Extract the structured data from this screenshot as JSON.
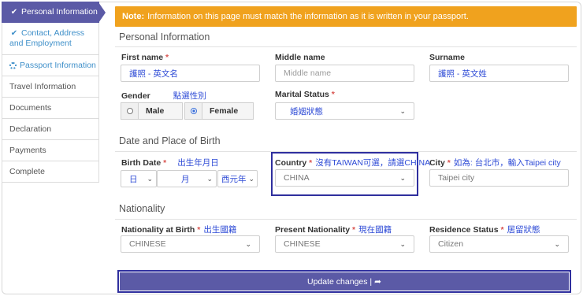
{
  "sidebar": {
    "items": [
      {
        "label": "Personal Information",
        "icon": "check"
      },
      {
        "label": "Contact, Address and Employment",
        "icon": "check"
      },
      {
        "label": "Passport Information",
        "icon": "spinner"
      },
      {
        "label": "Travel Information"
      },
      {
        "label": "Documents"
      },
      {
        "label": "Declaration"
      },
      {
        "label": "Payments"
      },
      {
        "label": "Complete"
      }
    ]
  },
  "note": {
    "bold": "Note:",
    "text": "Information on this page must match the information as it is written in your passport."
  },
  "personal": {
    "title": "Personal Information",
    "first_name": {
      "label": "First name",
      "required": "*",
      "value": "護照 - 英文名"
    },
    "middle_name": {
      "label": "Middle name",
      "placeholder": "Middle name"
    },
    "surname": {
      "label": "Surname",
      "value": "護照 - 英文姓"
    },
    "gender": {
      "label": "Gender",
      "hint": "點選性別",
      "options": [
        "Male",
        "Female"
      ],
      "selected": "Female"
    },
    "marital": {
      "label": "Marital Status",
      "required": "*",
      "value": "婚姻狀態"
    }
  },
  "birth": {
    "title": "Date and Place of Birth",
    "date": {
      "label": "Birth Date",
      "required": "*",
      "hint": "出生年月日",
      "day": "日",
      "month": "月",
      "year": "西元年"
    },
    "country": {
      "label": "Country",
      "required": "*",
      "hint": "沒有TAIWAN可選，請選CHINA",
      "value": "CHINA"
    },
    "city": {
      "label": "City",
      "required": "*",
      "hint": "如為: 台北市，輸入Taipei city",
      "placeholder": "Taipei city"
    }
  },
  "nationality": {
    "title": "Nationality",
    "at_birth": {
      "label": "Nationality at Birth",
      "required": "*",
      "hint": "出生國籍",
      "value": "CHINESE"
    },
    "present": {
      "label": "Present Nationality",
      "required": "*",
      "hint": "現在國籍",
      "value": "CHINESE"
    },
    "residence": {
      "label": "Residence Status",
      "required": "*",
      "hint": "居留狀態",
      "value": "Citizen"
    }
  },
  "update_button": {
    "label": "Update changes |",
    "icon": "share-icon"
  },
  "colors": {
    "accent": "#5b5aa6",
    "note": "#f0a21e",
    "hint": "#2e4bd6",
    "highlight": "#2f2f9e"
  }
}
